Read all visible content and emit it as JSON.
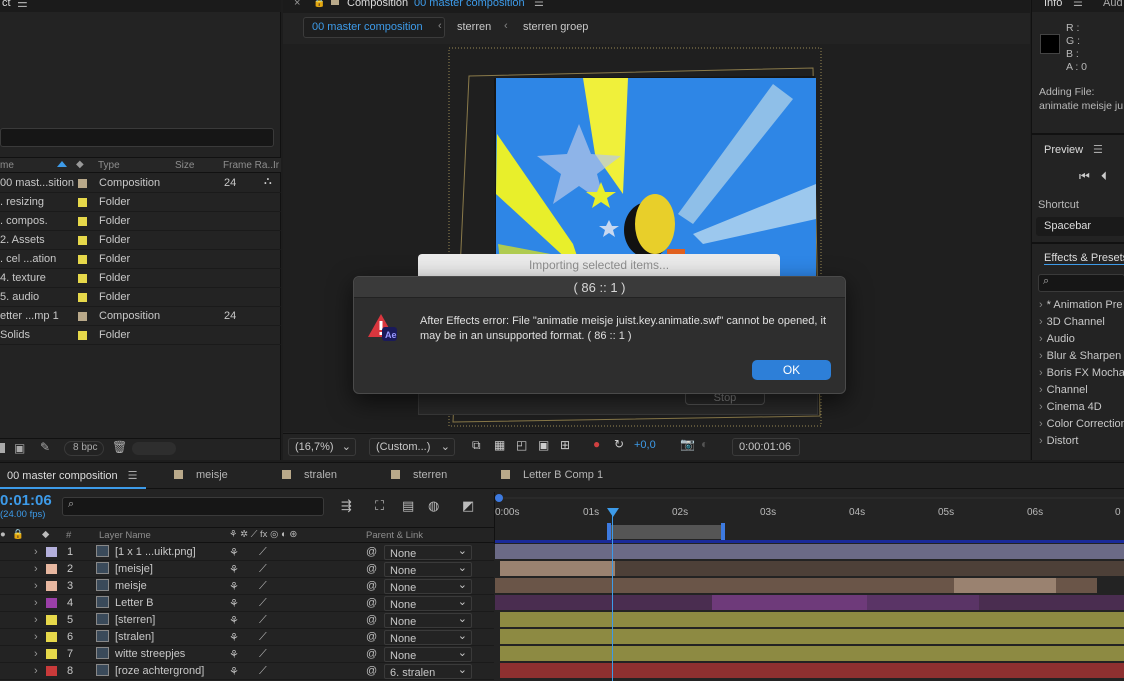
{
  "project": {
    "columns": {
      "name": "me",
      "type": "Type",
      "size": "Size",
      "frame_rate": "Frame Ra...",
      "in": "Ir"
    },
    "items": [
      {
        "name": "00 mast...sition",
        "type": "Composition",
        "frame_rate": "24",
        "color": "#b9a98a"
      },
      {
        "name": ". resizing",
        "type": "Folder",
        "frame_rate": "",
        "color": "#e6d84a"
      },
      {
        "name": ". compos.",
        "type": "Folder",
        "frame_rate": "",
        "color": "#e6d84a"
      },
      {
        "name": "2. Assets",
        "type": "Folder",
        "frame_rate": "",
        "color": "#e6d84a"
      },
      {
        "name": ". cel ...ation",
        "type": "Folder",
        "frame_rate": "",
        "color": "#e6d84a"
      },
      {
        "name": "4. texture",
        "type": "Folder",
        "frame_rate": "",
        "color": "#e6d84a"
      },
      {
        "name": "5. audio",
        "type": "Folder",
        "frame_rate": "",
        "color": "#e6d84a"
      },
      {
        "name": "etter ...mp 1",
        "type": "Composition",
        "frame_rate": "24",
        "color": "#b9a98a"
      },
      {
        "name": "Solids",
        "type": "Folder",
        "frame_rate": "",
        "color": "#e6d84a"
      }
    ],
    "bpc": "8 bpc"
  },
  "comp": {
    "title_prefix": "Composition",
    "title_name": "00 master composition",
    "breadcrumbs": [
      "00 master composition",
      "sterren",
      "sterren groep"
    ],
    "zoom": "(16,7%)",
    "resolution": "(Custom...)",
    "exposure": "+0,0",
    "timecode": "0:00:01:06"
  },
  "info": {
    "tab_info": "Info",
    "tab_audio": "Aud",
    "r": "R :",
    "g": "G :",
    "b": "B :",
    "a": "A :  0",
    "status1": "Adding File:",
    "status2": "animatie meisje ju"
  },
  "preview": {
    "title": "Preview",
    "shortcut_label": "Shortcut",
    "shortcut_value": "Spacebar"
  },
  "effects": {
    "title": "Effects & Presets",
    "items": [
      "* Animation Pre",
      "3D Channel",
      "Audio",
      "Blur & Sharpen",
      "Boris FX Mocha",
      "Channel",
      "Cinema 4D",
      "Color Correction",
      "Distort"
    ]
  },
  "dialog": {
    "title": "( 86 :: 1 )",
    "message": "After Effects error: File \"animatie meisje juist.key.animatie.swf\" cannot be opened, it may be in an unsupported format. ( 86 :: 1 )",
    "ok": "OK",
    "importing": "Importing selected items...",
    "stop": "Stop"
  },
  "timeline": {
    "tabs": [
      {
        "label": "00 master composition",
        "color": ""
      },
      {
        "label": "meisje",
        "color": "#b9a98a"
      },
      {
        "label": "stralen",
        "color": "#b9a98a"
      },
      {
        "label": "sterren",
        "color": "#b9a98a"
      },
      {
        "label": "Letter B Comp 1",
        "color": "#b9a98a"
      }
    ],
    "current_time": "0:01:06",
    "fps": "(24.00 fps)",
    "col_layer_name": "Layer Name",
    "col_parent": "Parent & Link",
    "col_num": "#",
    "ruler": [
      "0:00s",
      "01s",
      "02s",
      "03s",
      "04s",
      "05s",
      "06s",
      "0"
    ],
    "layers": [
      {
        "num": "1",
        "name": "[1 x 1 ...uikt.png]",
        "label": "#b4b0dc",
        "parent": "None"
      },
      {
        "num": "2",
        "name": "[meisje]",
        "label": "#e7b7a0",
        "parent": "None"
      },
      {
        "num": "3",
        "name": "meisje",
        "label": "#e7b7a0",
        "parent": "None"
      },
      {
        "num": "4",
        "name": "Letter B",
        "label": "#9b3fa8",
        "parent": "None"
      },
      {
        "num": "5",
        "name": "[sterren]",
        "label": "#e6d84a",
        "parent": "None"
      },
      {
        "num": "6",
        "name": "[stralen]",
        "label": "#e6d84a",
        "parent": "None"
      },
      {
        "num": "7",
        "name": "witte streepjes",
        "label": "#e6d84a",
        "parent": "None"
      },
      {
        "num": "8",
        "name": "[roze achtergrond]",
        "label": "#c93a3a",
        "parent": "6. stralen"
      }
    ]
  },
  "colors": {
    "accent": "#3d9be9",
    "sky": "#2e86e6",
    "ray": "#e8ef2b",
    "ok_button": "#2d7fd8"
  }
}
